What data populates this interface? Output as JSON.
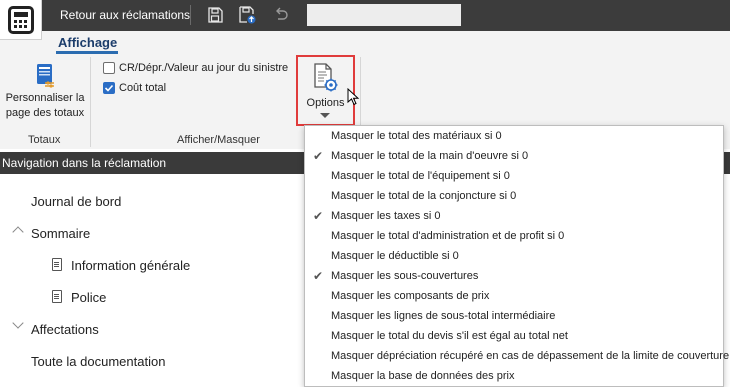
{
  "titlebar": {
    "back_label": "Retour aux réclamations",
    "save_icon": "save-icon",
    "save_upload_icon": "save-upload-icon",
    "undo_icon": "undo-icon"
  },
  "ribbon": {
    "tab_label": "Affichage",
    "personalize_label_line1": "Personnaliser la",
    "personalize_label_line2": "page des totaux",
    "group_totaux": "Totaux",
    "checkbox_cr_label": "CR/Dépr./Valeur au jour du sinistre",
    "checkbox_cr_checked": false,
    "checkbox_cout_label": "Coût total",
    "checkbox_cout_checked": true,
    "options_label": "Options",
    "group_afficher": "Afficher/Masquer"
  },
  "nav": {
    "header": "Navigation dans la réclamation",
    "items": [
      {
        "label": "Journal de bord"
      },
      {
        "label": "Sommaire"
      },
      {
        "label": "Information générale"
      },
      {
        "label": "Police"
      },
      {
        "label": "Affectations"
      },
      {
        "label": "Toute la documentation"
      }
    ]
  },
  "options_menu": {
    "items": [
      {
        "label": "Masquer le total des matériaux si 0",
        "checked": false
      },
      {
        "label": "Masquer le total de la main d'oeuvre si 0",
        "checked": true
      },
      {
        "label": "Masquer le total de l'équipement si 0",
        "checked": false
      },
      {
        "label": "Masquer le total de la conjoncture si 0",
        "checked": false
      },
      {
        "label": "Masquer les taxes si 0",
        "checked": true
      },
      {
        "label": "Masquer le total d'administration et de profit si 0",
        "checked": false
      },
      {
        "label": "Masquer le déductible si 0",
        "checked": false
      },
      {
        "label": "Masquer les sous-couvertures",
        "checked": true
      },
      {
        "label": "Masquer les composants de prix",
        "checked": false
      },
      {
        "label": "Masquer les lignes de sous-total intermédiaire",
        "checked": false
      },
      {
        "label": "Masquer le total du devis s'il est égal au total net",
        "checked": false
      },
      {
        "label": "Masquer dépréciation récupéré en cas de dépassement de la limite de couverture",
        "checked": false
      },
      {
        "label": "Masquer la base de données des prix",
        "checked": false
      }
    ]
  },
  "colors": {
    "titlebar": "#3c3c3c",
    "accent": "#2a6dc5",
    "highlight_border": "#e03b3b"
  }
}
